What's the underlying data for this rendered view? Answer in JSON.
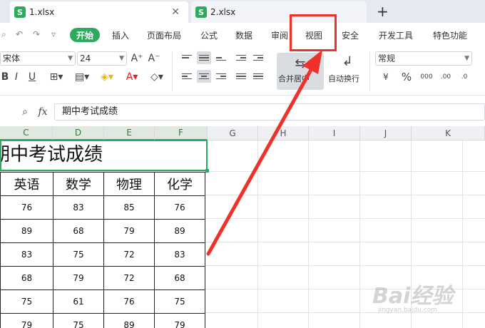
{
  "tabs": [
    {
      "icon": "S",
      "title": "1.xlsx",
      "close": "✕"
    },
    {
      "icon": "S",
      "title": "2.xlsx"
    }
  ],
  "tab_add": "+",
  "menu": {
    "start": "开始",
    "items": [
      "插入",
      "页面布局",
      "公式",
      "数据",
      "审阅",
      "视图",
      "安全",
      "开发工具",
      "特色功能"
    ]
  },
  "toolbar": {
    "font_name": "宋体",
    "font_size": "24",
    "merge_label": "合并居中",
    "wrap_label": "自动换行",
    "number_format": "常规",
    "percent": "%",
    "currency": "¥"
  },
  "formula": {
    "fx": "fx",
    "value": "期中考试成绩"
  },
  "columns": [
    "C",
    "D",
    "E",
    "F",
    "G",
    "H",
    "I",
    "J",
    "K"
  ],
  "sheet": {
    "title": "期中考试成绩",
    "headers": [
      "英语",
      "数学",
      "物理",
      "化学"
    ],
    "rows": [
      [
        "76",
        "83",
        "85",
        "76"
      ],
      [
        "89",
        "68",
        "79",
        "89"
      ],
      [
        "83",
        "75",
        "72",
        "83"
      ],
      [
        "68",
        "79",
        "72",
        "68"
      ],
      [
        "75",
        "61",
        "76",
        "75"
      ],
      [
        "79",
        "75",
        "89",
        "79"
      ]
    ]
  },
  "watermark": {
    "brand": "Bai经验",
    "url": "jingyan.baidu.com"
  },
  "colors": {
    "accent": "#2eaa5e",
    "annotation": "#f0302a"
  }
}
